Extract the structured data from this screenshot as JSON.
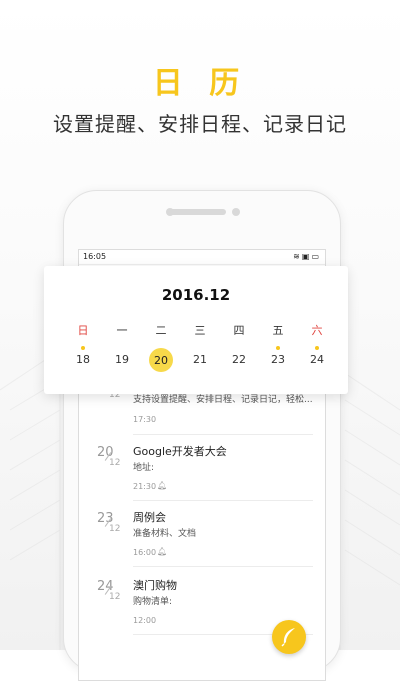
{
  "hero": {
    "title": "日 历",
    "subtitle": "设置提醒、安排日程、记录日记"
  },
  "statusbar": {
    "time": "16:05",
    "icons": [
      "wifi-icon",
      "sim-icon",
      "battery-icon"
    ]
  },
  "calendar": {
    "month": "2016.12",
    "weekdays": [
      {
        "label": "日",
        "weekend": true
      },
      {
        "label": "一",
        "weekend": false
      },
      {
        "label": "二",
        "weekend": false
      },
      {
        "label": "三",
        "weekend": false
      },
      {
        "label": "四",
        "weekend": false
      },
      {
        "label": "五",
        "weekend": false
      },
      {
        "label": "六",
        "weekend": true
      }
    ],
    "days": [
      {
        "num": "18",
        "dot": true,
        "selected": false
      },
      {
        "num": "19",
        "dot": false,
        "selected": false
      },
      {
        "num": "20",
        "dot": false,
        "selected": true
      },
      {
        "num": "21",
        "dot": false,
        "selected": false
      },
      {
        "num": "22",
        "dot": false,
        "selected": false
      },
      {
        "num": "23",
        "dot": true,
        "selected": false
      },
      {
        "num": "24",
        "dot": true,
        "selected": false
      }
    ],
    "accent_color": "#f7c61d",
    "weekend_color": "#e0443f"
  },
  "events": [
    {
      "day": "",
      "month": "12",
      "title": "",
      "desc": "支持设置提醒、安排日程、记录日记，轻松...",
      "time": "17:30",
      "bell": false
    },
    {
      "day": "20",
      "month": "12",
      "title": "Google开发者大会",
      "desc": "地址:",
      "time": "21:30",
      "bell": true
    },
    {
      "day": "23",
      "month": "12",
      "title": "周例会",
      "desc": "准备材料、文档",
      "time": "16:00",
      "bell": true
    },
    {
      "day": "24",
      "month": "12",
      "title": "澳门购物",
      "desc": "购物清单:",
      "time": "12:00",
      "bell": false
    }
  ],
  "fab": {
    "icon": "feather-icon"
  }
}
